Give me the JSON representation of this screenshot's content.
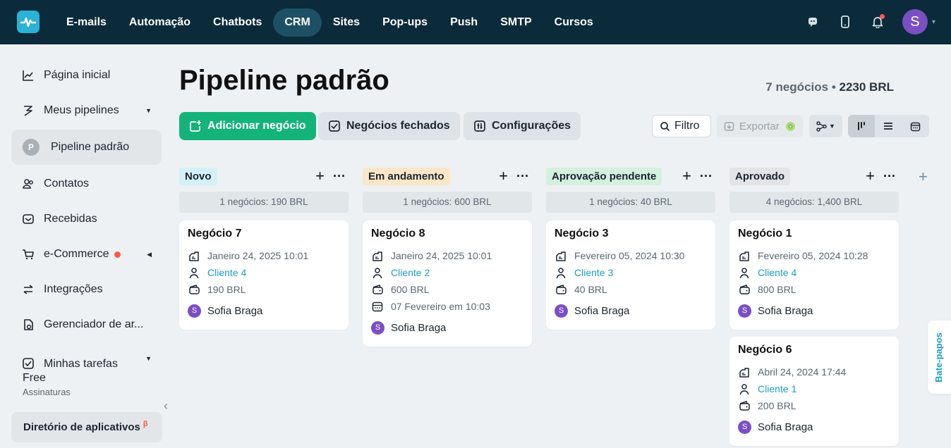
{
  "topnav": {
    "logo": "pulse-logo",
    "items": [
      "E-mails",
      "Automação",
      "Chatbots",
      "CRM",
      "Sites",
      "Pop-ups",
      "Push",
      "SMTP",
      "Cursos"
    ],
    "active": "CRM",
    "avatar_initial": "S"
  },
  "sidebar": {
    "items": [
      {
        "label": "Página inicial",
        "icon": "chart-line-icon"
      },
      {
        "label": "Meus pipelines",
        "icon": "lightning-icon"
      },
      {
        "label": "Pipeline padrão",
        "icon": "P"
      },
      {
        "label": "Contatos",
        "icon": "users-icon"
      },
      {
        "label": "Recebidas",
        "icon": "mail-icon"
      },
      {
        "label": "e-Commerce",
        "icon": "cart-icon"
      },
      {
        "label": "Integrações",
        "icon": "arrows-icon"
      },
      {
        "label": "Gerenciador de ar...",
        "icon": "file-manager-icon"
      },
      {
        "label": "Minhas tarefas",
        "icon": "task-icon"
      }
    ],
    "plan_name": "Free",
    "plan_sub": "Assinaturas",
    "app_directory": "Diretório de aplicativos",
    "beta": "β"
  },
  "header": {
    "title": "Pipeline padrão",
    "deals_count": "7 negócios",
    "separator": "•",
    "total": "2230 BRL"
  },
  "toolbar": {
    "add_deal": "Adicionar negócio",
    "closed_deals": "Negócios fechados",
    "settings": "Configurações",
    "filter": "Filtro",
    "export": "Exportar"
  },
  "colors": {
    "topbar": "#0b2a3a",
    "accent_green": "#14b37a",
    "link": "#1c9dc4"
  },
  "columns": [
    {
      "name": "Novo",
      "color": "#d4f1fb",
      "stats": "1 negócios: 190 BRL",
      "cards": [
        {
          "title": "Negócio 7",
          "date": "Janeiro 24, 2025 10:01",
          "client": "Cliente 4",
          "amount": "190 BRL",
          "owner": "Sofia Braga",
          "owner_initial": "S"
        }
      ]
    },
    {
      "name": "Em andamento",
      "color": "#fbe6c8",
      "stats": "1 negócios: 600 BRL",
      "cards": [
        {
          "title": "Negócio 8",
          "date": "Janeiro 24, 2025 10:01",
          "client": "Cliente 2",
          "amount": "600 BRL",
          "due": "07 Fevereiro em 10:03",
          "owner": "Sofia Braga",
          "owner_initial": "S"
        }
      ]
    },
    {
      "name": "Aprovação pendente",
      "color": "#d3f1de",
      "stats": "1 negócios: 40 BRL",
      "cards": [
        {
          "title": "Negócio 3",
          "date": "Fevereiro 05, 2024 10:30",
          "client": "Cliente 3",
          "amount": "40 BRL",
          "owner": "Sofia Braga",
          "owner_initial": "S"
        }
      ]
    },
    {
      "name": "Aprovado",
      "color": "#e2e4e6",
      "stats": "4 negócios: 1,400 BRL",
      "cards": [
        {
          "title": "Negócio 1",
          "date": "Fevereiro 05, 2024 10:28",
          "client": "Cliente 4",
          "amount": "800 BRL",
          "owner": "Sofia Braga",
          "owner_initial": "S"
        },
        {
          "title": "Negócio 6",
          "date": "Abril 24, 2024 17:44",
          "client": "Cliente 1",
          "amount": "200 BRL",
          "owner": "Sofia Braga",
          "owner_initial": "S"
        }
      ]
    }
  ],
  "chat_tab": "Bate-papos"
}
